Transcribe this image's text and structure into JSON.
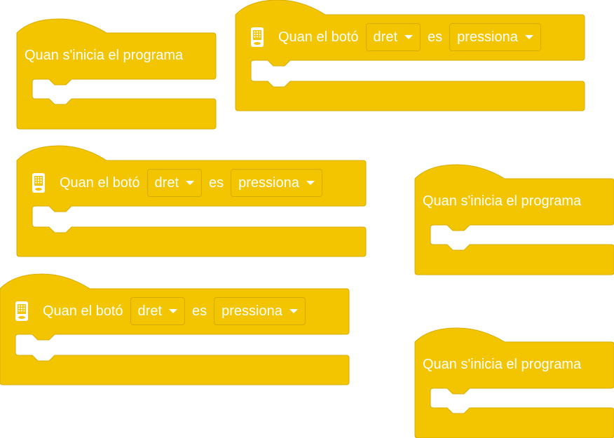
{
  "colors": {
    "block_fill": "#f3c500",
    "block_stroke": "#d8ac00",
    "text": "#ffffff"
  },
  "start_block": {
    "label": "Quan s'inicia el programa"
  },
  "button_block": {
    "icon": "hub-icon",
    "label": "Quan el botó",
    "button_value": "dret",
    "es_label": "es",
    "state_value": "pressiona"
  }
}
